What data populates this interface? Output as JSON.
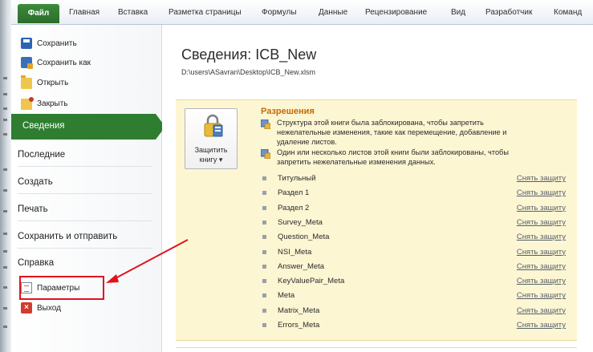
{
  "ribbon": {
    "file_tab": "Файл",
    "tabs": [
      "Главная",
      "Вставка",
      "Разметка страницы",
      "Формулы",
      "Данные",
      "Рецензирование",
      "Вид",
      "Разработчик",
      "Команд"
    ]
  },
  "nav": {
    "save": "Сохранить",
    "save_as": "Сохранить как",
    "open": "Открыть",
    "close": "Закрыть",
    "info": "Сведения",
    "recent": "Последние",
    "new": "Создать",
    "print": "Печать",
    "save_send": "Сохранить и отправить",
    "help": "Справка",
    "options": "Параметры",
    "exit": "Выход"
  },
  "main": {
    "title": "Сведения: ICB_New",
    "path": "D:\\users\\ASavran\\Desktop\\ICB_New.xlsm"
  },
  "permissions": {
    "protect_button_line1": "Защитить",
    "protect_button_line2": "книгу ▾",
    "title": "Разрешения",
    "structure_line1": "Структура этой книги была заблокирована, чтобы запретить",
    "structure_line2": "нежелательные изменения, такие как перемещение, добавление и",
    "structure_line3": "удаление листов.",
    "sheets_line1": "Один или несколько листов этой книги были заблокированы, чтобы",
    "sheets_line2": "запретить нежелательные изменения данных.",
    "unprotect_label": "Снять защиту",
    "sheets": [
      "Титульный",
      "Раздел 1",
      "Раздел 2",
      "Survey_Meta",
      "Question_Meta",
      "NSI_Meta",
      "Answer_Meta",
      "KeyValuePair_Meta",
      "Meta",
      "Matrix_Meta",
      "Errors_Meta"
    ]
  },
  "colors": {
    "accent_green": "#2f7d31",
    "permissions_title": "#c66a00",
    "annotation_red": "#e0141b",
    "panel_bg": "#fdf6d3"
  }
}
